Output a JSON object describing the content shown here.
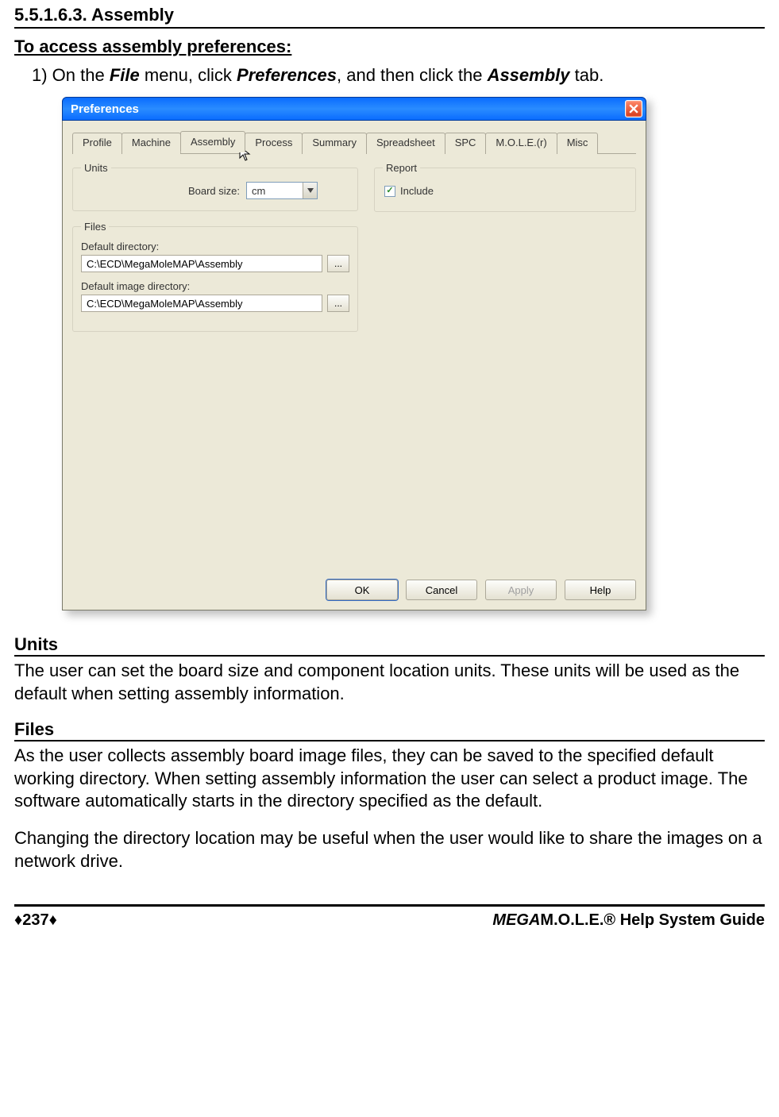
{
  "section_number": "5.5.1.6.3. Assembly",
  "access_heading": "To access assembly preferences:",
  "step1_prefix": "1) On the ",
  "step1_file": "File",
  "step1_mid1": " menu, click ",
  "step1_prefs": "Preferences",
  "step1_mid2": ", and then click the ",
  "step1_asm": "Assembly",
  "step1_suffix": " tab.",
  "dialog": {
    "title": "Preferences",
    "tabs": [
      "Profile",
      "Machine",
      "Assembly",
      "Process",
      "Summary",
      "Spreadsheet",
      "SPC",
      "M.O.L.E.(r)",
      "Misc"
    ],
    "active_tab_index": 2,
    "units_legend": "Units",
    "board_size_label": "Board size:",
    "board_size_value": "cm",
    "report_legend": "Report",
    "include_label": "Include",
    "include_checked": true,
    "files_legend": "Files",
    "default_dir_label": "Default directory:",
    "default_dir_value": "C:\\ECD\\MegaMoleMAP\\Assembly",
    "default_img_label": "Default image directory:",
    "default_img_value": "C:\\ECD\\MegaMoleMAP\\Assembly",
    "browse_label": "...",
    "buttons": {
      "ok": "OK",
      "cancel": "Cancel",
      "apply": "Apply",
      "help": "Help"
    }
  },
  "units_head": "Units",
  "units_para": "The user can set the board size and component location units. These units will be used as the default when setting assembly information.",
  "files_head": "Files",
  "files_para1": "As the user collects assembly board image files, they can be saved to the specified default working directory. When setting assembly information the user can select a product image. The software automatically starts in the directory specified as the default.",
  "files_para2": "Changing the directory location may be useful when the user would like to share the images on a network drive.",
  "footer": {
    "page": "♦237♦",
    "guide_mega": "MEGA",
    "guide_rest": "M.O.L.E.® Help System Guide"
  }
}
